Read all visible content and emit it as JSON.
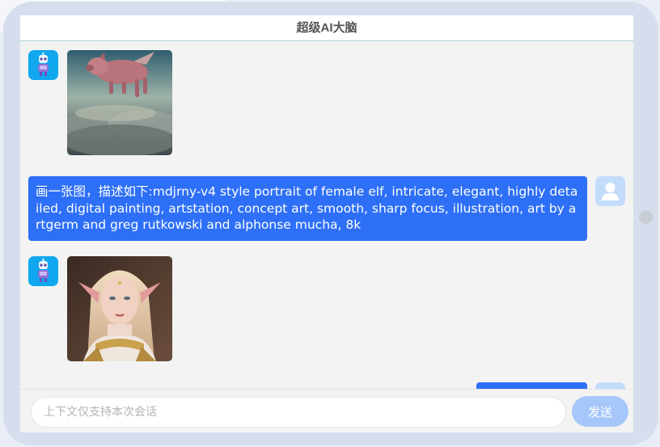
{
  "app": {
    "title": "超级AI大脑"
  },
  "messages": [
    {
      "role": "bot",
      "type": "image",
      "image_description": "flying pig above clouds"
    },
    {
      "role": "user",
      "type": "text",
      "text": "画一张图，描述如下:mdjrny-v4 style portrait of female elf, intricate, elegant, highly detailed, digital painting, artstation, concept art, smooth, sharp focus, illustration, art by artgerm and greg rutkowski and alphonse mucha, 8k"
    },
    {
      "role": "bot",
      "type": "image",
      "image_description": "portrait of female elf"
    },
    {
      "role": "user",
      "type": "text",
      "text": ""
    }
  ],
  "input": {
    "placeholder": "上下文仅支持本次会话",
    "value": ""
  },
  "send_button": {
    "label": "发送"
  },
  "colors": {
    "accent": "#2d6ff7",
    "send_button": "#a6c7fa",
    "bot_avatar": "#10a7ee",
    "user_avatar": "#c3dcfb",
    "frame": "#d6deee"
  }
}
